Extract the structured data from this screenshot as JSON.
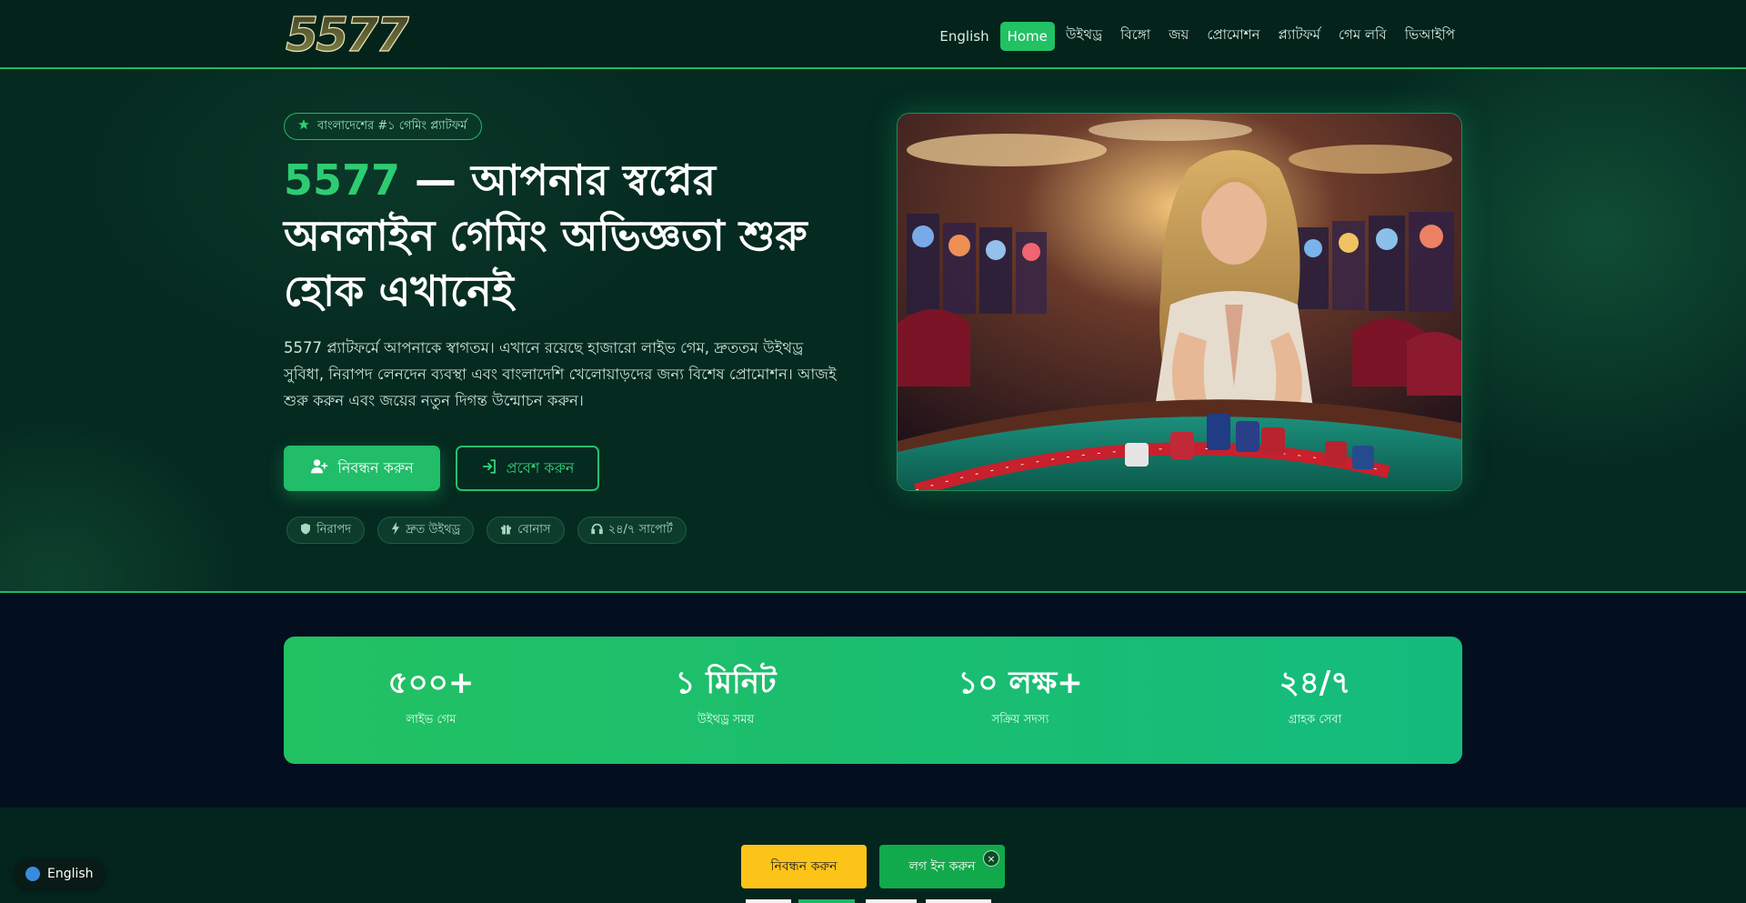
{
  "header": {
    "logo_text": "5577",
    "nav": [
      {
        "label": "English"
      },
      {
        "label": "Home",
        "active": true
      },
      {
        "label": "উইথড্র"
      },
      {
        "label": "বিঙ্গো"
      },
      {
        "label": "জয়"
      },
      {
        "label": "প্রোমোশন"
      },
      {
        "label": "প্ল্যাটফর্ম"
      },
      {
        "label": "গেম লবি"
      },
      {
        "label": "ভিআইপি"
      }
    ]
  },
  "hero": {
    "tag": "বাংলাদেশের #১ গেমিং প্ল্যাটফর্ম",
    "title_brand": "5577",
    "title_rest": " — আপনার স্বপ্নের অনলাইন গেমিং অভিজ্ঞতা শুরু হোক এখানেই",
    "description": "5577 প্ল্যাটফর্মে আপনাকে স্বাগতম। এখানে রয়েছে হাজারো লাইভ গেম, দ্রুততম উইথড্র সুবিধা, নিরাপদ লেনদেন ব্যবস্থা এবং বাংলাদেশি খেলোয়াড়দের জন্য বিশেষ প্রোমোশন। আজই শুরু করুন এবং জয়ের নতুন দিগন্ত উন্মোচন করুন।",
    "register_button": "নিবন্ধন করুন",
    "login_button": "প্রবেশ করুন",
    "pills": [
      {
        "label": "নিরাপদ",
        "icon": "shield-icon"
      },
      {
        "label": "দ্রুত উইথড্র",
        "icon": "bolt-icon"
      },
      {
        "label": "বোনাস",
        "icon": "gift-icon"
      },
      {
        "label": "২৪/৭ সাপোর্ট",
        "icon": "headset-icon"
      }
    ]
  },
  "stats": [
    {
      "value": "৫০০+",
      "label": "লাইভ গেম"
    },
    {
      "value": "১ মিনিট",
      "label": "উইথড্র সময়"
    },
    {
      "value": "১০ লক্ষ+",
      "label": "সক্রিয় সদস্য"
    },
    {
      "value": "২৪/৭",
      "label": "গ্রাহক সেবা"
    }
  ],
  "language_switch": {
    "label": "English"
  },
  "bottom_bar": {
    "register": "নিবন্ধন করুন",
    "login": "লগ ইন করুন",
    "close": "×"
  },
  "colors": {
    "accent": "#22c164",
    "gold": "#fcc419",
    "bg": "#04251d"
  }
}
